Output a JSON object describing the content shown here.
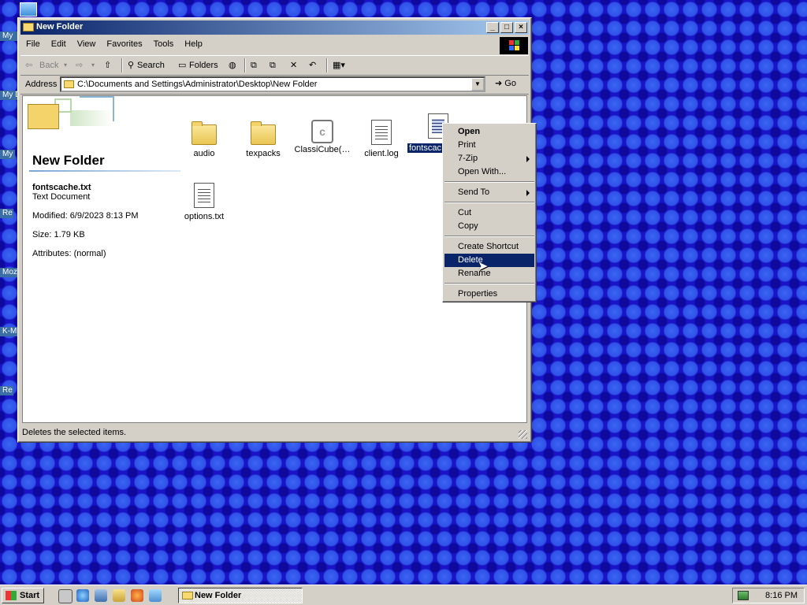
{
  "desktop": {
    "icons": [
      "My",
      "My D",
      "My",
      "Re",
      "Moz",
      "K-M",
      "Re"
    ]
  },
  "window": {
    "title": "New Folder",
    "buttons": {
      "minimize": "_",
      "maximize": "□",
      "close": "×"
    },
    "menu": [
      "File",
      "Edit",
      "View",
      "Favorites",
      "Tools",
      "Help"
    ],
    "toolbar": {
      "back": "Back",
      "search": "Search",
      "folders": "Folders"
    },
    "address": {
      "label": "Address",
      "path": "C:\\Documents and Settings\\Administrator\\Desktop\\New Folder",
      "go": "Go"
    },
    "status": "Deletes the selected items."
  },
  "panel": {
    "folder_title": "New Folder",
    "selected_name": "fontscache.txt",
    "selected_type": "Text Document",
    "modified": "Modified: 6/9/2023 8:13 PM",
    "size": "Size: 1.79 KB",
    "attributes": "Attributes: (normal)"
  },
  "files": [
    {
      "name": "audio",
      "icon": "folder-icon"
    },
    {
      "name": "texpacks",
      "icon": "folder-icon"
    },
    {
      "name": "ClassiCube(…",
      "icon": "classicube-icon"
    },
    {
      "name": "client.log",
      "icon": "text-file-icon"
    },
    {
      "name": "fontscac",
      "icon": "text-file-icon",
      "selected": true
    },
    {
      "name": "options.txt",
      "icon": "text-file-icon"
    }
  ],
  "context_menu": {
    "items": {
      "open": "Open",
      "print": "Print",
      "zip": "7-Zip",
      "open_with": "Open With...",
      "send_to": "Send To",
      "cut": "Cut",
      "copy": "Copy",
      "create_shortcut": "Create Shortcut",
      "delete": "Delete",
      "rename": "Rename",
      "properties": "Properties"
    },
    "highlighted": "Delete"
  },
  "taskbar": {
    "start": "Start",
    "task": "New Folder",
    "clock": "8:16 PM"
  },
  "colors": {
    "desktop": "#1a14c8",
    "title_active": "#0a246a",
    "selection": "#0a246a",
    "face": "#d4d0c8"
  }
}
